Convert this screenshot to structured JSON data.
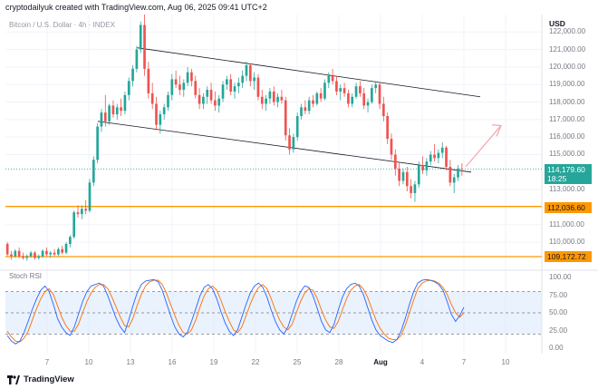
{
  "header": {
    "attribution": "cryptodailyuk created with TradingView.com, Aug 06, 2025 09:41 UTC+2",
    "symbol": "Bitcoin / U.S. Dollar · 4h · INDEX"
  },
  "axis": {
    "currency": "USD",
    "price_ticks": [
      "122,000.00",
      "121,000.00",
      "120,000.00",
      "119,000.00",
      "118,000.00",
      "117,000.00",
      "116,000.00",
      "115,000.00",
      "113,000.00",
      "111,000.00",
      "110,000.00"
    ],
    "current_price": "114,179.60",
    "countdown": "18:25",
    "line1_price": "112,036.60",
    "line2_price": "109,172.72",
    "time_ticks": [
      "7",
      "10",
      "13",
      "16",
      "19",
      "22",
      "25",
      "28",
      "Aug",
      "4",
      "7",
      "10"
    ],
    "rsi_ticks": [
      "100.00",
      "75.00",
      "50.00",
      "25.00",
      "0.00"
    ]
  },
  "indicator": {
    "name": "Stoch RSI"
  },
  "footer": {
    "brand": "TradingView"
  },
  "colors": {
    "up": "#26a69a",
    "down": "#ef5350",
    "level": "#ff9800",
    "k_line": "#2962ff",
    "d_line": "#ff6d00",
    "band": "#d7e7fb"
  },
  "chart_data": {
    "type": "candlestick",
    "y_range": [
      108500,
      123000
    ],
    "price_levels": [
      112036.6,
      109172.72
    ],
    "ohlc": [
      [
        109900,
        110000,
        109200,
        109300
      ],
      [
        109300,
        109500,
        109000,
        109200
      ],
      [
        109200,
        109600,
        109100,
        109500
      ],
      [
        109500,
        109700,
        109100,
        109200
      ],
      [
        109200,
        109400,
        109000,
        109100
      ],
      [
        109100,
        109300,
        108950,
        109200
      ],
      [
        109200,
        109500,
        109100,
        109400
      ],
      [
        109400,
        109500,
        109000,
        109100
      ],
      [
        109100,
        109300,
        109000,
        109200
      ],
      [
        109200,
        109600,
        109100,
        109500
      ],
      [
        109500,
        109700,
        109200,
        109300
      ],
      [
        109300,
        109500,
        109100,
        109400
      ],
      [
        109400,
        109600,
        109200,
        109300
      ],
      [
        109300,
        109700,
        109200,
        109600
      ],
      [
        109600,
        109800,
        109300,
        109400
      ],
      [
        109400,
        110000,
        109300,
        109900
      ],
      [
        109900,
        110400,
        109700,
        110300
      ],
      [
        110300,
        111800,
        110200,
        111700
      ],
      [
        111700,
        112100,
        111400,
        111600
      ],
      [
        111600,
        112100,
        111300,
        111900
      ],
      [
        111900,
        112400,
        111600,
        111800
      ],
      [
        111800,
        113600,
        111700,
        113400
      ],
      [
        113400,
        114900,
        113200,
        114700
      ],
      [
        114700,
        116800,
        114500,
        116600
      ],
      [
        116600,
        117600,
        116300,
        117400
      ],
      [
        117400,
        118400,
        116600,
        116900
      ],
      [
        116900,
        117900,
        116700,
        117800
      ],
      [
        117800,
        118100,
        117100,
        117300
      ],
      [
        117300,
        117900,
        117000,
        117700
      ],
      [
        117700,
        118200,
        117200,
        117500
      ],
      [
        117500,
        118600,
        117300,
        118400
      ],
      [
        118400,
        119400,
        118100,
        119200
      ],
      [
        119200,
        120100,
        118900,
        119900
      ],
      [
        119900,
        121200,
        119700,
        121000
      ],
      [
        121000,
        122600,
        120800,
        122400
      ],
      [
        122400,
        123000,
        119500,
        119900
      ],
      [
        119900,
        120300,
        118200,
        118500
      ],
      [
        118500,
        119100,
        117600,
        117900
      ],
      [
        117900,
        118300,
        116400,
        116700
      ],
      [
        116700,
        117500,
        116200,
        117300
      ],
      [
        117300,
        117900,
        117000,
        117700
      ],
      [
        117700,
        118600,
        117500,
        118400
      ],
      [
        118400,
        119600,
        118100,
        119300
      ],
      [
        119300,
        119800,
        118800,
        119000
      ],
      [
        119000,
        119500,
        118400,
        118700
      ],
      [
        118700,
        119300,
        118300,
        119100
      ],
      [
        119100,
        120000,
        118900,
        119700
      ],
      [
        119700,
        119900,
        118900,
        119200
      ],
      [
        119200,
        119500,
        118200,
        118400
      ],
      [
        118400,
        118800,
        117600,
        117900
      ],
      [
        117900,
        118500,
        117600,
        118300
      ],
      [
        118300,
        118900,
        117900,
        118700
      ],
      [
        118700,
        119100,
        117900,
        118100
      ],
      [
        118100,
        118600,
        117500,
        117800
      ],
      [
        117800,
        118400,
        117400,
        118200
      ],
      [
        118200,
        119200,
        118000,
        119000
      ],
      [
        119000,
        119500,
        118700,
        119300
      ],
      [
        119300,
        119600,
        118400,
        118600
      ],
      [
        118600,
        119100,
        118200,
        118900
      ],
      [
        118900,
        119400,
        118500,
        119100
      ],
      [
        119100,
        119800,
        118800,
        119500
      ],
      [
        119500,
        120300,
        119200,
        120100
      ],
      [
        120100,
        120200,
        118900,
        119200
      ],
      [
        119200,
        119700,
        118700,
        119400
      ],
      [
        119400,
        119600,
        118100,
        118300
      ],
      [
        118300,
        118700,
        117600,
        117900
      ],
      [
        117900,
        118400,
        117500,
        118200
      ],
      [
        118200,
        118800,
        117900,
        118600
      ],
      [
        118600,
        118900,
        117800,
        118000
      ],
      [
        118000,
        118500,
        117700,
        118300
      ],
      [
        118300,
        118700,
        117900,
        118100
      ],
      [
        118100,
        118300,
        115800,
        116100
      ],
      [
        116100,
        116500,
        115000,
        115300
      ],
      [
        115300,
        116200,
        115100,
        116000
      ],
      [
        116000,
        117400,
        115800,
        117200
      ],
      [
        117200,
        117900,
        117000,
        117700
      ],
      [
        117700,
        118100,
        117300,
        117500
      ],
      [
        117500,
        118300,
        117300,
        118100
      ],
      [
        118100,
        118400,
        117700,
        117900
      ],
      [
        117900,
        118600,
        117800,
        118500
      ],
      [
        118500,
        118800,
        118000,
        118200
      ],
      [
        118200,
        119300,
        118100,
        119100
      ],
      [
        119100,
        119700,
        118800,
        119500
      ],
      [
        119500,
        119900,
        119000,
        119200
      ],
      [
        119200,
        119500,
        118400,
        118600
      ],
      [
        118600,
        119000,
        118100,
        118800
      ],
      [
        118800,
        119100,
        118300,
        118500
      ],
      [
        118500,
        118700,
        117700,
        117900
      ],
      [
        117900,
        118500,
        117700,
        118300
      ],
      [
        118300,
        119100,
        118200,
        118900
      ],
      [
        118900,
        119200,
        118300,
        118500
      ],
      [
        118500,
        118800,
        117600,
        117800
      ],
      [
        117800,
        118200,
        117400,
        118000
      ],
      [
        118000,
        119000,
        117900,
        118800
      ],
      [
        118800,
        119200,
        118500,
        119000
      ],
      [
        119000,
        119100,
        117600,
        117900
      ],
      [
        117900,
        118300,
        116900,
        117200
      ],
      [
        117200,
        117400,
        115600,
        115900
      ],
      [
        115900,
        116200,
        114700,
        115000
      ],
      [
        115000,
        115300,
        113800,
        114200
      ],
      [
        114200,
        114600,
        113200,
        113500
      ],
      [
        113500,
        114200,
        113300,
        114000
      ],
      [
        114000,
        114300,
        112900,
        113200
      ],
      [
        113200,
        113600,
        112500,
        112800
      ],
      [
        112800,
        113500,
        112300,
        113300
      ],
      [
        113300,
        114600,
        113100,
        114400
      ],
      [
        114400,
        114900,
        113900,
        114100
      ],
      [
        114100,
        114800,
        113800,
        114600
      ],
      [
        114600,
        115200,
        114400,
        115000
      ],
      [
        115000,
        115600,
        114600,
        114800
      ],
      [
        114800,
        115300,
        114500,
        115100
      ],
      [
        115100,
        115700,
        114800,
        115400
      ],
      [
        115400,
        115500,
        114100,
        114300
      ],
      [
        114300,
        114700,
        113200,
        113400
      ],
      [
        113400,
        113900,
        112800,
        113700
      ],
      [
        113700,
        114400,
        113500,
        114200
      ],
      [
        114200,
        114500,
        113800,
        114180
      ]
    ],
    "stoch_rsi_k": [
      18,
      10,
      6,
      10,
      22,
      38,
      55,
      70,
      82,
      88,
      80,
      62,
      42,
      30,
      22,
      18,
      30,
      48,
      66,
      80,
      88,
      90,
      92,
      88,
      74,
      58,
      42,
      30,
      22,
      40,
      60,
      78,
      90,
      95,
      96,
      97,
      94,
      82,
      64,
      46,
      30,
      20,
      16,
      22,
      38,
      56,
      74,
      86,
      90,
      84,
      70,
      52,
      36,
      24,
      18,
      26,
      44,
      62,
      78,
      88,
      92,
      86,
      72,
      54,
      38,
      26,
      20,
      30,
      48,
      66,
      80,
      88,
      86,
      74,
      56,
      38,
      26,
      22,
      34,
      54,
      72,
      84,
      90,
      92,
      88,
      76,
      58,
      40,
      26,
      18,
      14,
      10,
      8,
      12,
      24,
      42,
      62,
      80,
      92,
      96,
      97,
      96,
      94,
      90,
      82,
      66,
      48,
      38,
      46,
      58
    ],
    "stoch_rsi_d": [
      24,
      16,
      10,
      9,
      14,
      24,
      40,
      56,
      70,
      80,
      84,
      76,
      60,
      44,
      32,
      24,
      24,
      34,
      50,
      66,
      78,
      86,
      90,
      90,
      84,
      72,
      58,
      44,
      32,
      30,
      42,
      60,
      76,
      88,
      94,
      96,
      96,
      90,
      78,
      62,
      46,
      32,
      22,
      20,
      26,
      40,
      58,
      74,
      84,
      88,
      82,
      68,
      52,
      38,
      26,
      22,
      30,
      46,
      62,
      76,
      86,
      90,
      84,
      70,
      54,
      40,
      30,
      26,
      34,
      50,
      66,
      78,
      84,
      82,
      70,
      54,
      40,
      30,
      28,
      38,
      54,
      70,
      82,
      88,
      90,
      84,
      72,
      56,
      40,
      28,
      20,
      14,
      12,
      12,
      18,
      32,
      50,
      68,
      84,
      92,
      95,
      96,
      95,
      92,
      86,
      76,
      62,
      50,
      44,
      50
    ],
    "stoch_range": [
      0,
      100
    ],
    "stoch_band": [
      20,
      80
    ]
  }
}
